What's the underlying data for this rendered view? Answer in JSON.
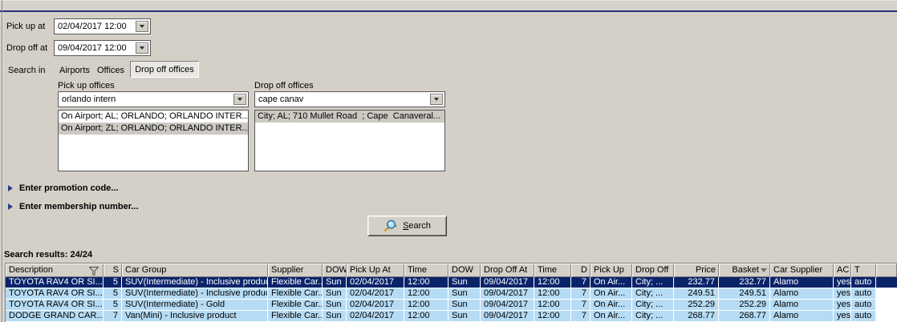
{
  "form": {
    "pickup_at": {
      "label": "Pick up at",
      "value": "02/04/2017 12:00"
    },
    "dropoff_at": {
      "label": "Drop off at",
      "value": "09/04/2017 12:00"
    },
    "search_in": {
      "label": "Search in",
      "tabs": [
        {
          "label": "Airports",
          "selected": false
        },
        {
          "label": "Offices",
          "selected": false
        },
        {
          "label": "Drop off offices",
          "selected": true
        }
      ]
    },
    "pickup_offices": {
      "label": "Pick up offices",
      "combo_value": "orlando intern",
      "options": [
        {
          "text": "On Airport; AL; ORLANDO; ORLANDO INTER...",
          "selected": false
        },
        {
          "text": "On Airport; ZL; ORLANDO; ORLANDO INTER...",
          "selected": true
        }
      ]
    },
    "dropoff_offices": {
      "label": "Drop off offices",
      "combo_value": "cape canav",
      "options": [
        {
          "text": "City; AL; 710 Mullet Road  ; Cape  Canaveral...",
          "selected": true
        }
      ]
    },
    "promo_label": "Enter promotion code...",
    "membership_label": "Enter membership number...",
    "search_button": {
      "accel": "S",
      "rest": "earch"
    }
  },
  "results": {
    "summary": "Search results: 24/24",
    "columns": [
      "Description",
      "S",
      "Car Group",
      "Supplier",
      "DOW",
      "Pick Up At",
      "Time",
      "DOW",
      "Drop Off At",
      "Time",
      "D",
      "Pick Up",
      "Drop Off",
      "Price",
      "Basket",
      "Car Supplier",
      "AC",
      "T"
    ],
    "sorted_column": "Basket",
    "filtered_column": "Description",
    "selected_row": 0,
    "rows": [
      [
        "TOYOTA RAV4 OR SI...",
        "5",
        "SUV(Intermediate) - Inclusive product",
        "Flexible Car...",
        "Sun",
        "02/04/2017",
        "12:00",
        "Sun",
        "09/04/2017",
        "12:00",
        "7",
        "On Air...",
        "City; ...",
        "232.77",
        "232.77",
        "Alamo",
        "yes",
        "auto"
      ],
      [
        "TOYOTA RAV4 OR SI...",
        "5",
        "SUV(Intermediate) - Inclusive product...",
        "Flexible Car...",
        "Sun",
        "02/04/2017",
        "12:00",
        "Sun",
        "09/04/2017",
        "12:00",
        "7",
        "On Air...",
        "City; ...",
        "249.51",
        "249.51",
        "Alamo",
        "yes",
        "auto"
      ],
      [
        "TOYOTA RAV4 OR SI...",
        "5",
        "SUV(Intermediate) - Gold",
        "Flexible Car...",
        "Sun",
        "02/04/2017",
        "12:00",
        "Sun",
        "09/04/2017",
        "12:00",
        "7",
        "On Air...",
        "City; ...",
        "252.29",
        "252.29",
        "Alamo",
        "yes",
        "auto"
      ],
      [
        "DODGE GRAND CAR...",
        "7",
        "Van(Mini) - Inclusive product",
        "Flexible Car...",
        "Sun",
        "02/04/2017",
        "12:00",
        "Sun",
        "09/04/2017",
        "12:00",
        "7",
        "On Air...",
        "City; ...",
        "268.77",
        "268.77",
        "Alamo",
        "yes",
        "auto"
      ]
    ]
  },
  "colors": {
    "selection": "#0a246a",
    "row_highlight": "#b6dcf5",
    "accent_line": "#2a327b",
    "panel": "#d4d0c8"
  }
}
